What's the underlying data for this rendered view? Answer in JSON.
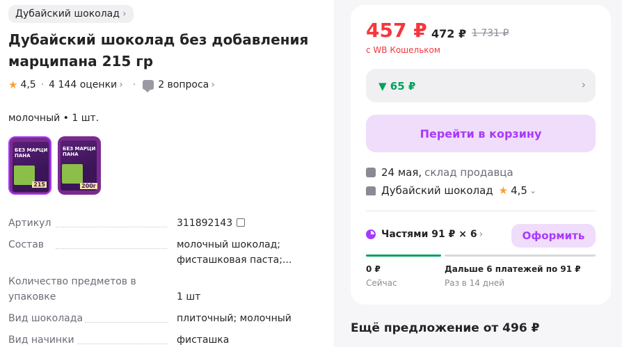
{
  "breadcrumb": {
    "label": "Дубайский шоколад",
    "chevron": "›"
  },
  "product": {
    "title": "Дубайский шоколад без добавления марципана 215 гр",
    "rating": "4,5",
    "ratings_count": "4 144 оценки",
    "questions": "2 вопроса",
    "separator": "·"
  },
  "variant": {
    "label": "молочный • 1 шт.",
    "thumbs": [
      {
        "text": "БЕЗ МАРЦИ ПАНА",
        "weight": "215",
        "selected": true
      },
      {
        "text": "БЕЗ МАРЦИ ПАНА",
        "weight": "200г",
        "selected": false
      }
    ]
  },
  "specs": [
    {
      "key": "Артикул",
      "value": "311892143"
    },
    {
      "key": "Состав",
      "value": "молочный шоколад;\nфисташковая паста;..."
    },
    {
      "key": "Количество предметов в\nупаковке",
      "value": "1 шт"
    },
    {
      "key": "Вид шоколада",
      "value": "плиточный; молочный"
    },
    {
      "key": "Вид начинки",
      "value": "фисташка"
    }
  ],
  "buy": {
    "price": "457 ₽",
    "price_no_wallet": "472 ₽",
    "price_old": "1 731 ₽",
    "wallet_note": "с WB Кошельком",
    "discount": "▼ 65 ₽",
    "cart_button": "Перейти в корзину",
    "delivery_date": "24 мая,",
    "delivery_source": "склад продавца",
    "seller_name": "Дубайский шоколад",
    "seller_rating": "4,5",
    "installments_label": "Частями 91 ₽ × 6",
    "pay_button": "Оформить",
    "first_payment": "0 ₽",
    "first_payment_when": "Сейчас",
    "next_payments": "Дальше 6 платежей по 91 ₽",
    "next_payments_when": "Раз в 14 дней"
  },
  "more_offers": "Ещё предложение от 496 ₽",
  "colors": {
    "accent": "#a73afd",
    "price": "#f3373e",
    "green": "#00a15d"
  },
  "icons": [
    "star-icon",
    "question-icon",
    "copy-icon",
    "box-icon",
    "shop-icon",
    "installment-icon",
    "chevron-right-icon",
    "chevron-down-icon"
  ]
}
